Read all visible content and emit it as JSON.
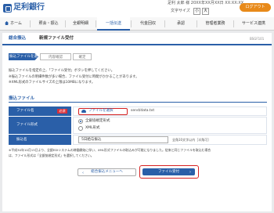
{
  "header": {
    "bank_name": "足利銀行",
    "user_info": "足利 太郎 様 20XX年XX月XX日 XX:XX:XX",
    "logout": "ログアウト",
    "font_size_label": "文字サイズ",
    "font_small": "小",
    "font_large": "大"
  },
  "nav": {
    "items": [
      "ホーム",
      "照会・振込",
      "全銀明細",
      "一括伝送",
      "代金回収",
      "承認",
      "管理者業務",
      "サービス連携"
    ],
    "active_index": 3
  },
  "page": {
    "breadcrumb": "総合振込",
    "title": "新規ファイル受付",
    "screen_id": "BSGF101",
    "steps": [
      "振込ファイルを選択",
      "内容確認",
      "確定"
    ],
    "description": [
      "振込ファイルを指定の上、「ファイル受付」ボタンを押してください。",
      "※振込ファイルの明細件数が多い場合、ファイル受付に時間がかかることがあります。",
      "※XML形式のファイルサイズの上限は10MBになります。"
    ]
  },
  "form": {
    "section_title": "振込ファイル",
    "file_name_label": "ファイル名",
    "required_badge": "必須",
    "select_file_button": "ファイルを選択",
    "selected_file": "send/data.txt",
    "file_format_label": "ファイル形式",
    "format_options": [
      "全銀協規定形式",
      "XML形式"
    ],
    "format_selected": 0,
    "transfer_name_label": "振込名",
    "transfer_name_value": "5日給与振込",
    "transfer_name_hint": "全角10文字以内［半角可］",
    "note_1": "※平成30年10月15日より、全銀EDIシステムの稼働開始に伴い、XML形式ファイルの取込みが可能になりました。従来と同じファイルを取込む場合",
    "note_2": "は、ファイル形式は「全銀協規定形式」を選択してください。"
  },
  "buttons": {
    "back": "総合振込メニューへ",
    "submit": "ファイル受付"
  },
  "colors": {
    "primary": "#2a5fa8",
    "accent_orange": "#e88a1a",
    "highlight_red": "#d62020"
  }
}
